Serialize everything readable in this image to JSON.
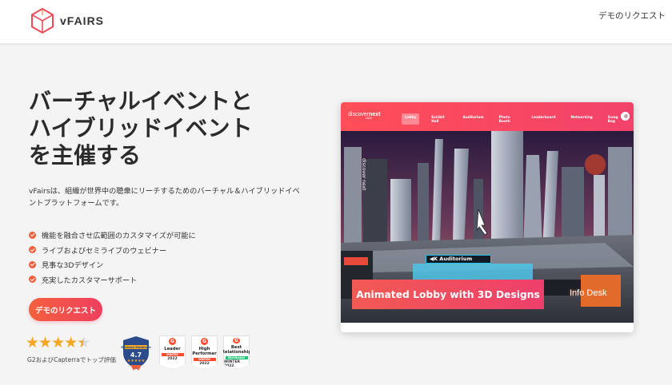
{
  "header": {
    "logo_text": "vFAIRS",
    "demo_link": "デモのリクエスト"
  },
  "hero": {
    "title_lines": [
      "バーチャルイベントと",
      "ハイブリッドイベント",
      "を主催する"
    ],
    "description": "vFairsは、組織が世界中の聴衆にリーチするためのバーチャル＆ハイブリッドイベントプラットフォームです。",
    "features": [
      "機能を融合させ広範囲のカスタマイズが可能に",
      "ライブおよびセミライブのウェビナー",
      "見事な3Dデザイン",
      "充実したカスタマーサポート"
    ],
    "cta_label": "デモのリクエスト"
  },
  "rating": {
    "stars": 4.5,
    "caption": "G2およびCapterraでトップ評価"
  },
  "badges": {
    "capterra": {
      "label": "Reviews Moderate",
      "score": "4.7"
    },
    "g2": [
      {
        "title": "Leader",
        "band": "WINTER",
        "year": "2022",
        "band_color": "#ff492c"
      },
      {
        "title": "High Performer",
        "band": "WINTER",
        "year": "2022",
        "band_color": "#ff492c"
      },
      {
        "title": "Best Relationship",
        "band": "Mid-Market",
        "year": "WINTER 2022",
        "band_color": "#1ec47a"
      }
    ]
  },
  "screenshot": {
    "brand_prefix": "discover",
    "brand_suffix": "next",
    "brand_sub": "2022",
    "tabs": [
      "Lobby",
      "Exhibit Hall",
      "Auditorium",
      "Photo Booth",
      "Leaderboard",
      "Networking",
      "Swag Bag"
    ],
    "active_tab": 0,
    "banner": "Animated Lobby with 3D Designs",
    "info_desk": "Info Desk",
    "auditorium_sign": "◀K Auditorium",
    "tower_text": "discover next",
    "accent_color": "#f2426a"
  }
}
